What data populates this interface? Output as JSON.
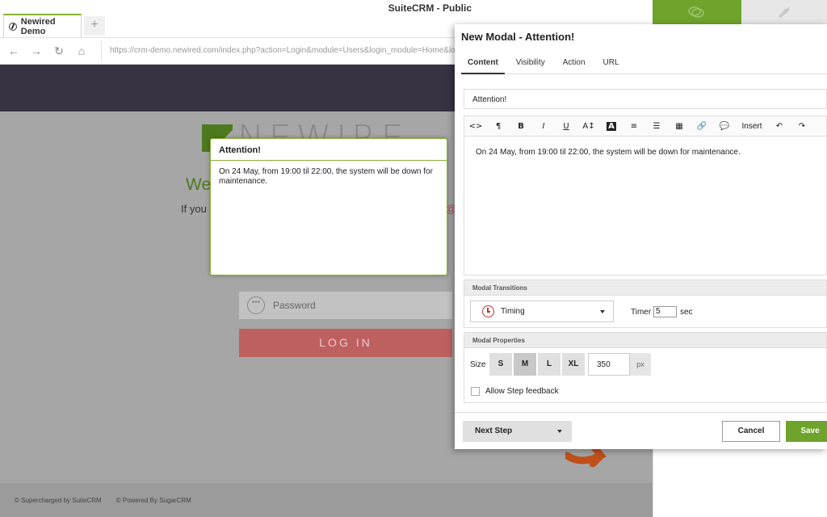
{
  "browser": {
    "tab_label": "Newired Demo",
    "new_tab_symbol": "+",
    "app_title": "SuiteCRM - Public",
    "url": "https://crm-demo.newired.com/index.php?action=Login&module=Users&login_module=Home&login_"
  },
  "page": {
    "logo_text": "NEWIRE",
    "welcome_start": "We",
    "welcome_end": "e",
    "ifyou_start": "If you",
    "ifyou_end": "@",
    "password_placeholder": "Password",
    "login_label": "LOG IN",
    "footer_supercharged": "© Supercharged by SuiteCRM",
    "footer_powered": "© Powered By SugarCRM"
  },
  "preview": {
    "title": "Attention!",
    "body": "On 24 May, from 19:00 til 22:00, the system will be down for maintenance."
  },
  "editor": {
    "title": "New Modal - Attention!",
    "tabs": [
      {
        "label": "Content"
      },
      {
        "label": "Visibility"
      },
      {
        "label": "Action"
      },
      {
        "label": "URL"
      }
    ],
    "title_value": "Attention!",
    "toolbar": {
      "code": "<>",
      "paragraph": "¶",
      "bold": "B",
      "italic": "I",
      "underline": "U",
      "font_size": "A↕",
      "font_color": "A",
      "align": "≡",
      "list": "☰",
      "table": "▦",
      "link": "🔗",
      "comment": "💬",
      "insert": "Insert",
      "undo": "↶",
      "redo": "↷"
    },
    "content_text": "On 24 May, from 19:00 til 22:00, the system will be down for maintenance.",
    "transitions_header": "Modal Transitions",
    "timing_value": "Timing",
    "timer_label": "Timer",
    "timer_value": "5",
    "timer_unit": "sec",
    "properties_header": "Modal Properties",
    "size_label": "Size",
    "sizes": [
      "S",
      "M",
      "L",
      "XL"
    ],
    "selected_size": "M",
    "size_px_value": "350",
    "size_unit": "px",
    "feedback_label": "Allow Step feedback",
    "feedback_checked": false,
    "next_step_label": "Next Step",
    "cancel_label": "Cancel",
    "save_label": "Save"
  },
  "colors": {
    "accent_green": "#6ea32c",
    "header_dark": "#383243",
    "login_red": "#bf6060"
  },
  "icons": {
    "chat": "chat-bubbles-icon",
    "rocket": "rocket-icon"
  }
}
